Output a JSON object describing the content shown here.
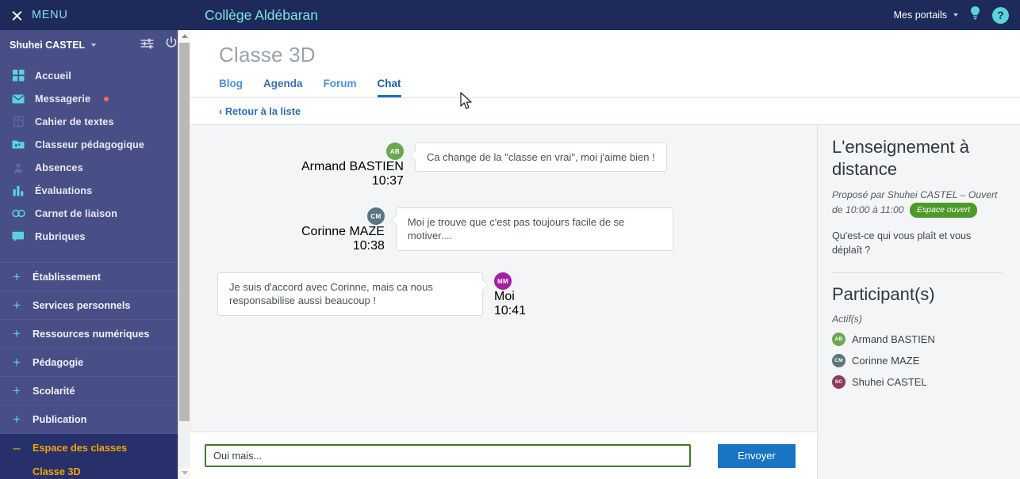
{
  "sidebar": {
    "menu_label": "MENU",
    "close_icon": "close-x-icon",
    "user": {
      "name": "Shuhei CASTEL",
      "settings_icon": "sliders-icon",
      "power_icon": "power-icon"
    },
    "nav_items": [
      {
        "label": "Accueil",
        "icon": "grid-icon",
        "badge": false
      },
      {
        "label": "Messagerie",
        "icon": "envelope-icon",
        "badge": true
      },
      {
        "label": "Cahier de textes",
        "icon": "notebook-icon",
        "badge": false
      },
      {
        "label": "Classeur pédagogique",
        "icon": "folder-icon",
        "badge": false
      },
      {
        "label": "Absences",
        "icon": "person-icon",
        "badge": false
      },
      {
        "label": "Évaluations",
        "icon": "bar-chart-icon",
        "badge": false
      },
      {
        "label": "Carnet de liaison",
        "icon": "link-icon",
        "badge": false
      },
      {
        "label": "Rubriques",
        "icon": "speech-bubble-icon",
        "badge": false
      }
    ],
    "sections": [
      {
        "label": "Établissement",
        "sign": "+",
        "active": false
      },
      {
        "label": "Services personnels",
        "sign": "+",
        "active": false
      },
      {
        "label": "Ressources numériques",
        "sign": "+",
        "active": false
      },
      {
        "label": "Pédagogie",
        "sign": "+",
        "active": false
      },
      {
        "label": "Scolarité",
        "sign": "+",
        "active": false
      },
      {
        "label": "Publication",
        "sign": "+",
        "active": false
      },
      {
        "label": "Espace des classes",
        "sign": "–",
        "active": true
      }
    ],
    "sub_item": "Classe 3D",
    "accent_active": "#f0a800",
    "bg": "#474f86"
  },
  "topbar": {
    "title": "Collège Aldébaran",
    "portals_label": "Mes portails",
    "caret_icon": "chevron-down-icon",
    "bulb_icon": "lightbulb-icon",
    "help_icon": "help-question-icon",
    "help_glyph": "?"
  },
  "page": {
    "title": "Classe 3D",
    "tabs": [
      {
        "label": "Blog",
        "state": "default"
      },
      {
        "label": "Agenda",
        "state": "hover"
      },
      {
        "label": "Forum",
        "state": "default"
      },
      {
        "label": "Chat",
        "state": "active"
      }
    ],
    "back_link": "‹ Retour à la liste"
  },
  "chat": {
    "messages": [
      {
        "side": "left",
        "author": "Armand BASTIEN",
        "time": "10:37",
        "initials": "AB",
        "avatar_color": "#6aa94f",
        "text": "Ca change de la \"classe en vrai\", moi j'aime bien !"
      },
      {
        "side": "left",
        "author": "Corinne MAZE",
        "time": "10:38",
        "initials": "CM",
        "avatar_color": "#5c7480",
        "text": "Moi je trouve que c'est pas toujours facile de se motiver...."
      },
      {
        "side": "right",
        "author": "Moi",
        "time": "10:41",
        "initials": "MM",
        "avatar_color": "#a61fa6",
        "text": "Je suis d'accord avec Corinne, mais ca nous responsabilise aussi beaucoup !"
      }
    ],
    "composer": {
      "value": "Oui mais...",
      "placeholder": "Oui mais...",
      "send_label": "Envoyer",
      "send_color": "#1775c4",
      "input_border": "#3f7a28"
    }
  },
  "right_panel": {
    "title": "L'enseignement à distance",
    "subtitle": "Proposé par Shuhei CASTEL – Ouvert de 10:00 à 11:00",
    "badge": "Espace ouvert",
    "badge_color": "#4c9a2a",
    "question": "Qu'est-ce qui vous plaît et vous déplaît ?",
    "participants_title": "Participant(s)",
    "participants_state": "Actif(s)",
    "participants": [
      {
        "name": "Armand BASTIEN",
        "initials": "AB",
        "color": "#6aa94f"
      },
      {
        "name": "Corinne MAZE",
        "initials": "CM",
        "color": "#5c7480"
      },
      {
        "name": "Shuhei CASTEL",
        "initials": "SC",
        "color": "#8e3b5e"
      }
    ]
  }
}
